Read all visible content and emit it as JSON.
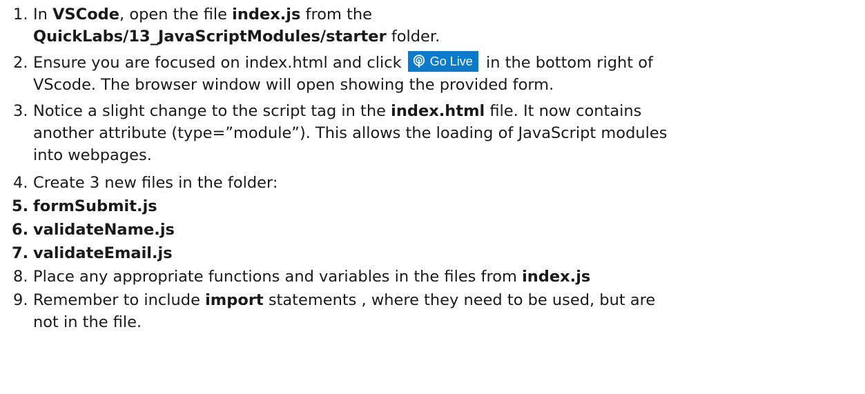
{
  "steps": [
    {
      "num": "1.",
      "parts": [
        "In ",
        "VSCode",
        ", open the file ",
        "index.js",
        " from the"
      ],
      "line2_bold": "QuickLabs/13_JavaScriptModules/starter",
      "line2_rest": " folder."
    },
    {
      "num": "2.",
      "before_button": "Ensure you are focused on index.html and click ",
      "button_label": "Go Live",
      "button_icon": "broadcast-icon",
      "after_button": " in the bottom right of",
      "line2": "VScode. The browser window will open showing the provided form."
    },
    {
      "num": "3.",
      "pre": "Notice a slight change to the script tag in the ",
      "bold": "index.html",
      "post": " file. It now contains",
      "line2": "another attribute (type=”module”). This allows the loading of JavaScript modules",
      "line3": "into webpages."
    },
    {
      "num": "4.",
      "text": "Create 3 new files in the folder:"
    },
    {
      "num": "5.",
      "text": "formSubmit.js"
    },
    {
      "num": "6.",
      "text": "validateName.js"
    },
    {
      "num": "7.",
      "text": "validateEmail.js"
    },
    {
      "num": "8.",
      "pre": "Place any appropriate functions and variables in the files from ",
      "bold": "index.js"
    },
    {
      "num": "9.",
      "pre": "Remember to include ",
      "bold": "import",
      "post": " statements , where they need to be used, but are",
      "line2": "not in the file."
    }
  ],
  "colors": {
    "go_live_bg": "#0a7acc",
    "text": "#1a1a1a"
  }
}
